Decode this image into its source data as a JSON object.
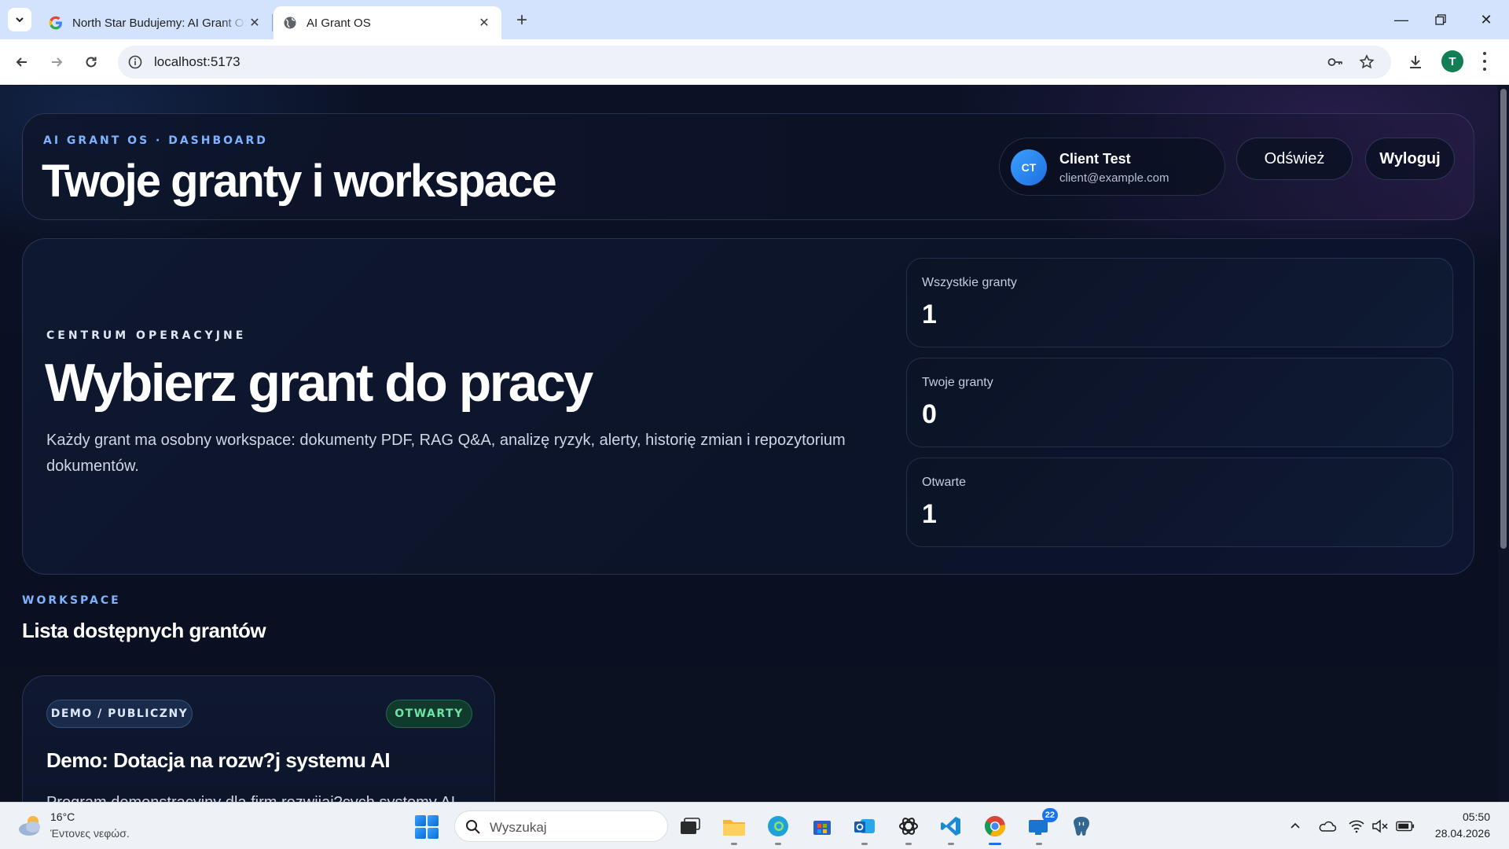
{
  "browser": {
    "tabs": [
      {
        "title": "North Star Budujemy: AI Grant OS",
        "active": false
      },
      {
        "title": "AI Grant OS",
        "active": true
      }
    ],
    "url": "localhost:5173",
    "profile_initial": "T"
  },
  "header": {
    "eyebrow": "AI GRANT OS · DASHBOARD",
    "title": "Twoje granty i workspace",
    "user": {
      "initials": "CT",
      "name": "Client Test",
      "email": "client@example.com"
    },
    "refresh_label": "Odśwież",
    "logout_label": "Wyloguj"
  },
  "hero": {
    "eyebrow": "CENTRUM OPERACYJNE",
    "title": "Wybierz grant do pracy",
    "description": "Każdy grant ma osobny workspace: dokumenty PDF, RAG Q&A, analizę ryzyk, alerty, historię zmian i repozytorium dokumentów.",
    "stats": [
      {
        "label": "Wszystkie granty",
        "value": "1"
      },
      {
        "label": "Twoje granty",
        "value": "0"
      },
      {
        "label": "Otwarte",
        "value": "1"
      }
    ]
  },
  "workspace": {
    "eyebrow": "WORKSPACE",
    "title": "Lista dostępnych grantów",
    "grants": [
      {
        "type_badge": "DEMO / PUBLICZNY",
        "status_badge": "OTWARTY",
        "title": "Demo: Dotacja na rozw?j systemu AI",
        "description": "Program demonstracyjny dla firm rozwijaj?cych systemy AI,"
      }
    ]
  },
  "taskbar": {
    "weather": {
      "temp": "16°C",
      "desc": "Έντονες νεφώσ."
    },
    "search_placeholder": "Wyszukaj",
    "notification_count": "22",
    "time": "05:50",
    "date": "28.04.2026"
  },
  "colors": {
    "accent_blue": "#7fb3ff",
    "status_green": "#6fe3a8",
    "page_bg": "#0b1022"
  }
}
